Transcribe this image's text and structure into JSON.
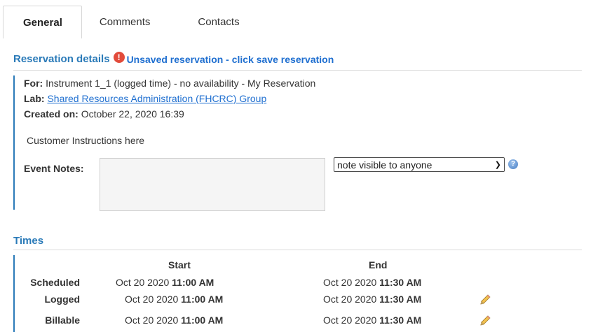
{
  "tabs": [
    "General",
    "Comments",
    "Contacts"
  ],
  "reservation": {
    "title": "Reservation details",
    "warning": "Unsaved reservation - click save reservation",
    "for_label": "For:",
    "for_value": "Instrument 1_1 (logged time) - no availability - My Reservation",
    "lab_label": "Lab:",
    "lab_link": "Shared Resources Administration (FHCRC) Group",
    "created_label": "Created on:",
    "created_value": "October 22, 2020 16:39",
    "instructions": "Customer Instructions here",
    "event_notes_label": "Event Notes:",
    "event_notes_value": "",
    "visibility_selected": "note visible to anyone"
  },
  "times": {
    "title": "Times",
    "start_header": "Start",
    "end_header": "End",
    "rows": [
      {
        "label": "Scheduled",
        "start_date": "Oct 20 2020",
        "start_time": "11:00 AM",
        "end_date": "Oct 20 2020",
        "end_time": "11:30 AM",
        "editable": false
      },
      {
        "label": "Logged",
        "start_date": "Oct 20 2020",
        "start_time": "11:00 AM",
        "end_date": "Oct 20 2020",
        "end_time": "11:30 AM",
        "editable": true
      },
      {
        "label": "Billable",
        "start_date": "Oct 20 2020",
        "start_time": "11:00 AM",
        "end_date": "Oct 20 2020",
        "end_time": "11:30 AM",
        "editable": true
      }
    ]
  },
  "icons": {
    "warning": "exclamation-circle-icon",
    "help": "question-circle-icon",
    "edit": "pencil-icon"
  },
  "colors": {
    "accent": "#2a7ab8",
    "link": "#1f6fd0",
    "warning": "#e24b3b"
  }
}
